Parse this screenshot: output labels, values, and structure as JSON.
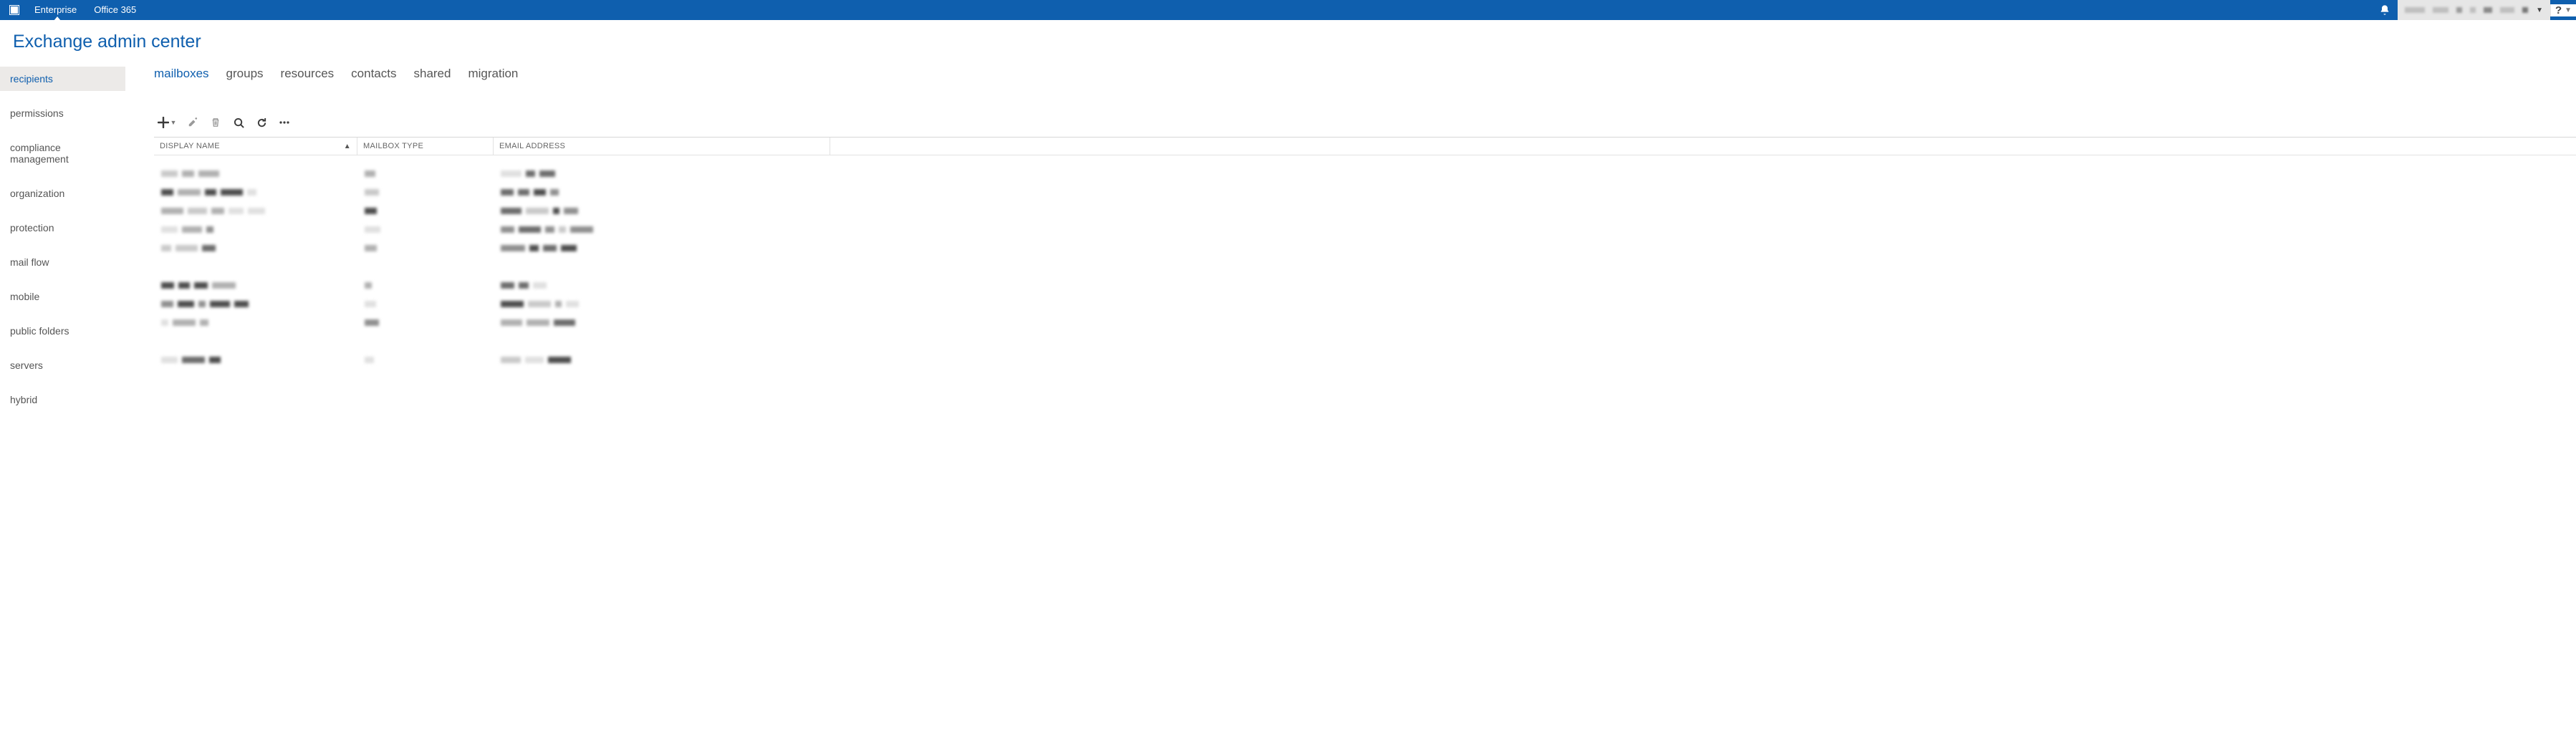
{
  "topbar": {
    "tab_enterprise": "Enterprise",
    "tab_office365": "Office 365"
  },
  "page_title": "Exchange admin center",
  "sidebar": {
    "items": [
      "recipients",
      "permissions",
      "compliance management",
      "organization",
      "protection",
      "mail flow",
      "mobile",
      "public folders",
      "servers",
      "hybrid"
    ],
    "selected_index": 0
  },
  "subnav": {
    "items": [
      "mailboxes",
      "groups",
      "resources",
      "contacts",
      "shared",
      "migration"
    ],
    "selected_index": 0
  },
  "toolbar": {
    "icons": [
      "add-icon",
      "edit-icon",
      "delete-icon",
      "search-icon",
      "refresh-icon",
      "more-icon"
    ]
  },
  "columns": {
    "display_name": "DISPLAY NAME",
    "mailbox_type": "MAILBOX TYPE",
    "email_address": "EMAIL ADDRESS",
    "sort_column": "display_name",
    "sort_dir": "asc"
  },
  "help_label": "?",
  "content_redacted": true
}
